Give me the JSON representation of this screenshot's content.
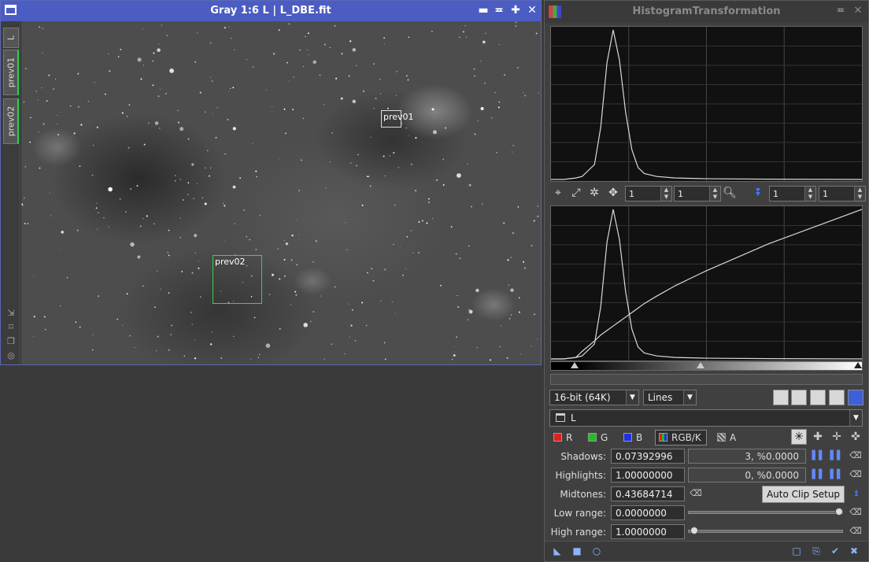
{
  "image_window": {
    "title": "Gray 1:6 L | L_DBE.fit",
    "tabs": [
      "L",
      "prev01",
      "prev02"
    ],
    "previews": [
      {
        "label": "prev01"
      },
      {
        "label": "prev02"
      }
    ]
  },
  "histogram": {
    "title": "HistogramTransformation",
    "zoom_h1": "1",
    "zoom_v1": "1",
    "zoom_h2": "1",
    "zoom_v2": "1",
    "resolution": "16-bit (64K)",
    "graph_style": "Lines",
    "view_target": "L",
    "channels": {
      "r": "R",
      "g": "G",
      "b": "B",
      "rgbk": "RGB/K",
      "a": "A"
    },
    "shadows_label": "Shadows:",
    "shadows_value": "0.07392996",
    "shadows_clip": "3, %0.0000",
    "highlights_label": "Highlights:",
    "highlights_value": "1.00000000",
    "highlights_clip": "0, %0.0000",
    "midtones_label": "Midtones:",
    "midtones_value": "0.43684714",
    "auto_clip_label": "Auto Clip Setup",
    "low_range_label": "Low range:",
    "low_range_value": "0.0000000",
    "high_range_label": "High range:",
    "high_range_value": "1.0000000",
    "colors": {
      "red": "#e02020",
      "green": "#20c020",
      "blue": "#2030e0",
      "accent": "#4b5cc2"
    }
  },
  "chart_data": [
    {
      "type": "line",
      "x": [
        0.0,
        0.04,
        0.08,
        0.1,
        0.14,
        0.16,
        0.18,
        0.2,
        0.22,
        0.24,
        0.26,
        0.28,
        0.3,
        0.34,
        0.4,
        0.5,
        0.7,
        1.0
      ],
      "series": [
        {
          "values": [
            0,
            0,
            0.01,
            0.02,
            0.1,
            0.35,
            0.78,
            1.0,
            0.8,
            0.45,
            0.2,
            0.08,
            0.04,
            0.02,
            0.01,
            0.005,
            0.002,
            0.0
          ]
        }
      ],
      "xlim": [
        0,
        1
      ],
      "ylim": [
        0,
        1
      ],
      "grid": true
    },
    {
      "type": "line",
      "x": [
        0.0,
        0.04,
        0.08,
        0.1,
        0.14,
        0.16,
        0.18,
        0.2,
        0.22,
        0.24,
        0.26,
        0.28,
        0.3,
        0.34,
        0.4,
        0.5,
        0.7,
        1.0
      ],
      "series": [
        {
          "values": [
            0,
            0,
            0.01,
            0.02,
            0.1,
            0.35,
            0.78,
            1.0,
            0.8,
            0.45,
            0.2,
            0.08,
            0.04,
            0.02,
            0.01,
            0.005,
            0.002,
            0.0
          ]
        },
        {
          "values": [
            0,
            0,
            0.01,
            0.05,
            0.12,
            0.16,
            0.19,
            0.22,
            0.25,
            0.28,
            0.31,
            0.34,
            0.37,
            0.42,
            0.49,
            0.59,
            0.77,
            1.0
          ]
        }
      ],
      "xlim": [
        0,
        1
      ],
      "ylim": [
        0,
        1
      ],
      "grid": true
    }
  ]
}
